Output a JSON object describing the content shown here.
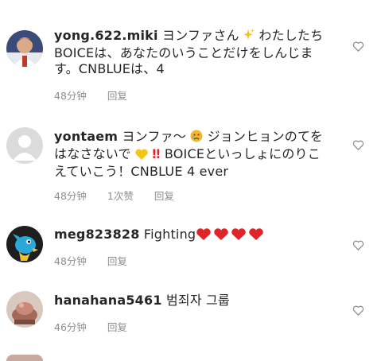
{
  "comments": [
    {
      "username": "yong.622.miki",
      "text_a": "ヨンファさん",
      "text_b": "わたしたちBOICEは、あなたのいうことだけをしんじます。CNBLUEは、4",
      "time": "48分钟",
      "likes": "",
      "reply": "回复",
      "avatar_icon": "user-photo-avatar"
    },
    {
      "username": "yontaem",
      "text_a": "ヨンファ～",
      "text_b": "ジョンヒョンのてをはなさないで",
      "text_c": "BOICEといっしょにのりこえていこう！CNBLUE 4 ever",
      "time": "48分钟",
      "likes": "1次赞",
      "reply": "回复",
      "avatar_icon": "default-avatar"
    },
    {
      "username": "meg823828",
      "text_a": "Fighting",
      "time": "48分钟",
      "reply": "回复",
      "avatar_icon": "cartoon-avatar"
    },
    {
      "username": "hanahana5461",
      "text_a": "범죄자 그룹",
      "time": "46分钟",
      "reply": "回复",
      "avatar_icon": "photo-avatar"
    }
  ],
  "colors": {
    "accent_red": "#e0242a",
    "meta_gray": "#8e8e8e",
    "text": "#262626"
  }
}
